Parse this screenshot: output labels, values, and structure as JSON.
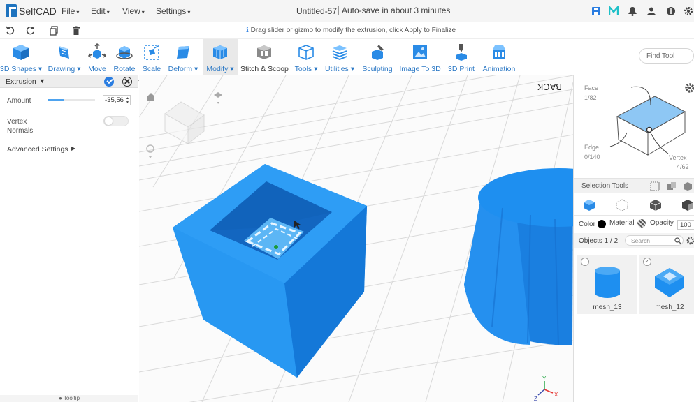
{
  "app": {
    "name": "SelfCAD",
    "document_title": "Untitled-57",
    "autosave_status": "Auto-save in about 3 minutes"
  },
  "menu": [
    "File",
    "Edit",
    "View",
    "Settings"
  ],
  "top_icons": [
    "save-icon",
    "m-icon",
    "bell-icon",
    "user-icon",
    "info-icon",
    "settings-icon"
  ],
  "hint": "Drag slider or gizmo to modify the extrusion, click Apply to Finalize",
  "toolbar": {
    "tools": [
      {
        "label": "3D Shapes",
        "icon": "cube-icon",
        "caret": true
      },
      {
        "label": "Drawing",
        "icon": "drawing-icon",
        "caret": true
      },
      {
        "label": "Move",
        "icon": "move-icon",
        "caret": false
      },
      {
        "label": "Rotate",
        "icon": "rotate-icon",
        "caret": false
      },
      {
        "label": "Scale",
        "icon": "scale-icon",
        "caret": false
      },
      {
        "label": "Deform",
        "icon": "deform-icon",
        "caret": true
      },
      {
        "label": "Modify",
        "icon": "modify-icon",
        "caret": true
      },
      {
        "label": "Stitch & Scoop",
        "icon": "stitch-scoop-icon",
        "caret": false
      },
      {
        "label": "Tools",
        "icon": "tools-icon",
        "caret": true
      },
      {
        "label": "Utilities",
        "icon": "utilities-icon",
        "caret": true
      },
      {
        "label": "Sculpting",
        "icon": "sculpting-icon",
        "caret": false
      },
      {
        "label": "Image To 3D",
        "icon": "image-to-3d-icon",
        "caret": false
      },
      {
        "label": "3D Print",
        "icon": "3d-print-icon",
        "caret": false
      },
      {
        "label": "Animation",
        "icon": "animation-icon",
        "caret": false
      }
    ],
    "find_tool_placeholder": "Find Tool"
  },
  "left_panel": {
    "title": "Extrusion",
    "amount_label": "Amount",
    "amount_value": "-35,56",
    "amount_slider_level": 0.35,
    "vertex_normals_label": "Vertex Normals",
    "vertex_normals_on": false,
    "advanced_settings_label": "Advanced Settings",
    "tooltip_label": "Tooltip"
  },
  "viewport": {
    "view_cube_face": "BACK",
    "axes": [
      "X",
      "Y",
      "Z"
    ]
  },
  "right_panel": {
    "face_label": "Face",
    "face_count": "1/82",
    "edge_label": "Edge",
    "edge_count": "0/140",
    "vertex_label": "Vertex",
    "vertex_count": "4/62",
    "selection_tools_label": "Selection Tools",
    "color_label": "Color",
    "color_value": "#000000",
    "material_label": "Material",
    "opacity_label": "Opacity",
    "opacity_value": "100",
    "objects_label": "Objects 1 / 2",
    "search_placeholder": "Search",
    "objects": [
      {
        "name": "mesh_13",
        "selected": false
      },
      {
        "name": "mesh_12",
        "selected": true
      }
    ]
  },
  "colors": {
    "accent": "#2a7de1",
    "mesh_blue": "#1e8ff0",
    "toolbar_label": "#2b78c5"
  }
}
